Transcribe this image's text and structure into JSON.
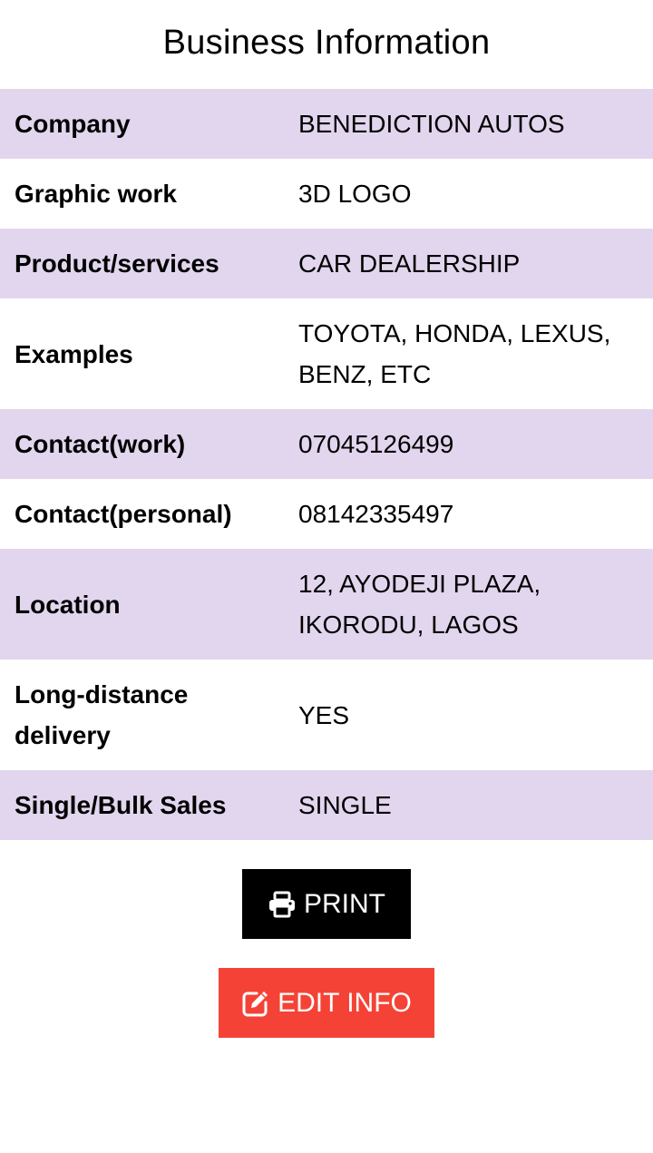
{
  "page": {
    "title": "Business Information"
  },
  "business_info": {
    "rows": [
      {
        "label": "Company",
        "value": "BENEDICTION AUTOS"
      },
      {
        "label": "Graphic work",
        "value": "3D LOGO"
      },
      {
        "label": "Product/services",
        "value": "CAR DEALERSHIP"
      },
      {
        "label": "Examples",
        "value": "TOYOTA, HONDA, LEXUS, BENZ, ETC"
      },
      {
        "label": "Contact(work)",
        "value": "07045126499"
      },
      {
        "label": "Contact(personal)",
        "value": "08142335497"
      },
      {
        "label": "Location",
        "value": "12, AYODEJI PLAZA, IKORODU, LAGOS"
      },
      {
        "label": "Long-distance delivery",
        "value": "YES"
      },
      {
        "label": "Single/Bulk Sales",
        "value": "SINGLE"
      }
    ]
  },
  "actions": {
    "print": {
      "label": "PRINT",
      "icon": "printer-icon"
    },
    "edit": {
      "label": "EDIT INFO",
      "icon": "edit-icon"
    }
  },
  "colors": {
    "row_shade": "#e2d6ee",
    "print_button": "#000000",
    "edit_button": "#f44336"
  }
}
